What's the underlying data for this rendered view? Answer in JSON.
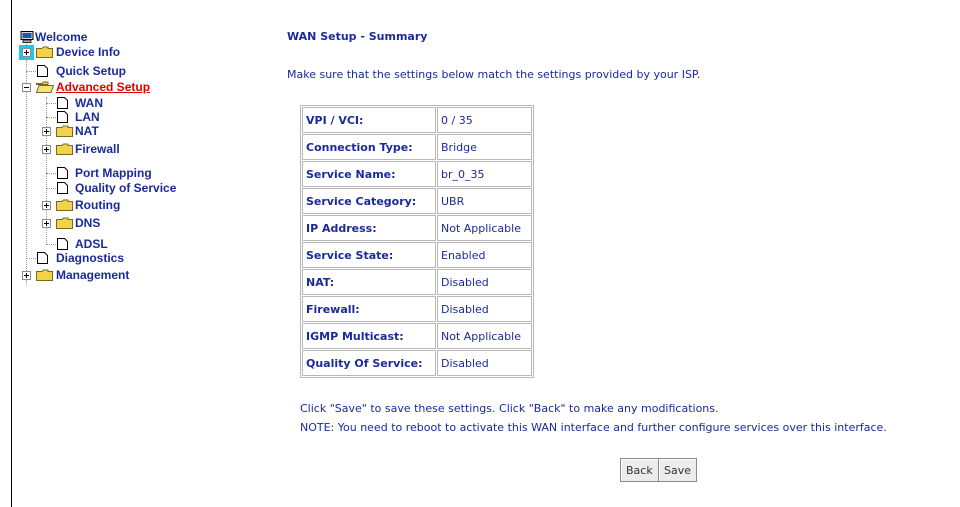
{
  "nav": {
    "welcome": "Welcome",
    "device_info": "Device Info",
    "quick_setup": "Quick Setup",
    "advanced_setup": "Advanced Setup",
    "wan": "WAN",
    "lan": "LAN",
    "nat": "NAT",
    "firewall": "Firewall",
    "port_mapping": "Port Mapping",
    "qos": "Quality of Service",
    "routing": "Routing",
    "dns": "DNS",
    "adsl": "ADSL",
    "diagnostics": "Diagnostics",
    "management": "Management"
  },
  "main": {
    "title": "WAN Setup - Summary",
    "intro": "Make sure that the settings below match the settings provided by your ISP.",
    "summary": [
      {
        "label": "VPI / VCI:",
        "value": "0 / 35"
      },
      {
        "label": "Connection Type:",
        "value": "Bridge"
      },
      {
        "label": "Service Name:",
        "value": "br_0_35"
      },
      {
        "label": "Service Category:",
        "value": "UBR"
      },
      {
        "label": "IP Address:",
        "value": "Not Applicable"
      },
      {
        "label": "Service State:",
        "value": "Enabled"
      },
      {
        "label": "NAT:",
        "value": "Disabled"
      },
      {
        "label": "Firewall:",
        "value": "Disabled"
      },
      {
        "label": "IGMP Multicast:",
        "value": "Not Applicable"
      },
      {
        "label": "Quality Of Service:",
        "value": "Disabled"
      }
    ],
    "note1": "Click \"Save\" to save these settings. Click \"Back\" to make any modifications.",
    "note2": "NOTE: You need to reboot to activate this WAN interface and further configure services over this interface.",
    "back_label": "Back",
    "save_label": "Save"
  },
  "colors": {
    "text": "#1a2a9c",
    "active_link": "#e00000",
    "selection": "#1ec8e8",
    "folder": "#f2d24a"
  }
}
